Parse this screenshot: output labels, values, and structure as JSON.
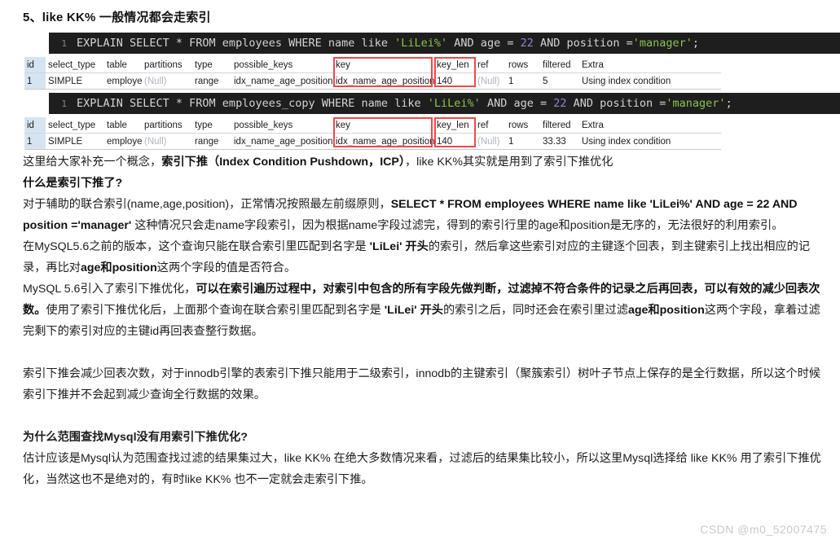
{
  "section": {
    "title": "5、like KK% 一般情况都会走索引"
  },
  "code_blocks": [
    {
      "line_number": "1",
      "prefix": "EXPLAIN SELECT * FROM employees WHERE name like ",
      "string1": "'LiLei%'",
      "mid1": " AND age = ",
      "number1": "22",
      "mid2": " AND position =",
      "string2": "'manager'",
      "suffix": ";"
    },
    {
      "line_number": "1",
      "prefix": "EXPLAIN SELECT * FROM employees_copy WHERE name like ",
      "string1": "'LiLei%'",
      "mid1": " AND age = ",
      "number1": "22",
      "mid2": " AND position =",
      "string2": "'manager'",
      "suffix": ";"
    }
  ],
  "explain_tables": [
    {
      "headers": [
        "id",
        "select_type",
        "table",
        "partitions",
        "type",
        "possible_keys",
        "key",
        "key_len",
        "ref",
        "rows",
        "filtered",
        "Extra"
      ],
      "row": {
        "id": "1",
        "select_type": "SIMPLE",
        "table": "employe",
        "partitions": "(Null)",
        "type": "range",
        "possible_keys": "idx_name_age_position",
        "key": "idx_name_age_position",
        "key_len": "140",
        "ref": "(Null)",
        "rows": "1",
        "filtered": "5",
        "extra": "Using index condition"
      }
    },
    {
      "headers": [
        "id",
        "select_type",
        "table",
        "partitions",
        "type",
        "possible_keys",
        "key",
        "key_len",
        "ref",
        "rows",
        "filtered",
        "Extra"
      ],
      "row": {
        "id": "1",
        "select_type": "SIMPLE",
        "table": "employe",
        "partitions": "(Null)",
        "type": "range",
        "possible_keys": "idx_name_age_position",
        "key": "idx_name_age_position",
        "key_len": "140",
        "ref": "(Null)",
        "rows": "1",
        "filtered": "33.33",
        "extra": "Using index condition"
      }
    }
  ],
  "prose": {
    "p1_a": "这里给大家补充一个概念，",
    "p1_b": "索引下推（Index Condition Pushdown，ICP）",
    "p1_c": "，like KK%其实就是用到了索引下推优化",
    "p2_heading": "什么是索引下推了?",
    "p3_a": "对于辅助的联合索引(name,age,position)，正常情况按照最左前缀原则，",
    "p3_b": "SELECT * FROM employees WHERE name like 'LiLei%' AND age = 22 AND position ='manager'",
    "p3_c": " 这种情况只会走name字段索引，因为根据name字段过滤完，得到的索引行里的age和position是无序的，无法很好的利用索引。",
    "p4_a": "在MySQL5.6之前的版本，这个查询只能在联合索引里匹配到名字是 ",
    "p4_b": "'LiLei' 开头",
    "p4_c": "的索引，然后拿这些索引对应的主键逐个回表，到主键索引上找出相应的记录，再比对",
    "p4_d": "age和position",
    "p4_e": "这两个字段的值是否符合。",
    "p5_a": "MySQL 5.6引入了索引下推优化，",
    "p5_b": "可以在索引遍历过程中，对索引中包含的所有字段先做判断，过滤掉不符合条件的记录之后再回表，可以有效的减少回表次数。",
    "p5_c": "使用了索引下推优化后，上面那个查询在联合索引里匹配到名字是 ",
    "p5_d": "'LiLei' 开头",
    "p5_e": "的索引之后，同时还会在索引里过滤",
    "p5_f": "age和position",
    "p5_g": "这两个字段，拿着过滤完剩下的索引对应的主键id再回表查整行数据。",
    "p6": "索引下推会减少回表次数，对于innodb引擎的表索引下推只能用于二级索引，innodb的主键索引（聚簇索引）树叶子节点上保存的是全行数据，所以这个时候索引下推并不会起到减少查询全行数据的效果。",
    "p7_heading": "为什么范围查找Mysql没有用索引下推优化?",
    "p8": "估计应该是Mysql认为范围查找过滤的结果集过大，like KK% 在绝大多数情况来看，过滤后的结果集比较小，所以这里Mysql选择给 like KK% 用了索引下推优化，当然这也不是绝对的，有时like KK% 也不一定就会走索引下推。"
  },
  "watermark": {
    "text": "CSDN @m0_52007475"
  },
  "colors": {
    "code_background": "#1e1e1e",
    "code_string": "#8bc34a",
    "code_number": "#9a7fd6",
    "highlight_box": "#f14848",
    "id_column_background": "#d6e4f2"
  }
}
